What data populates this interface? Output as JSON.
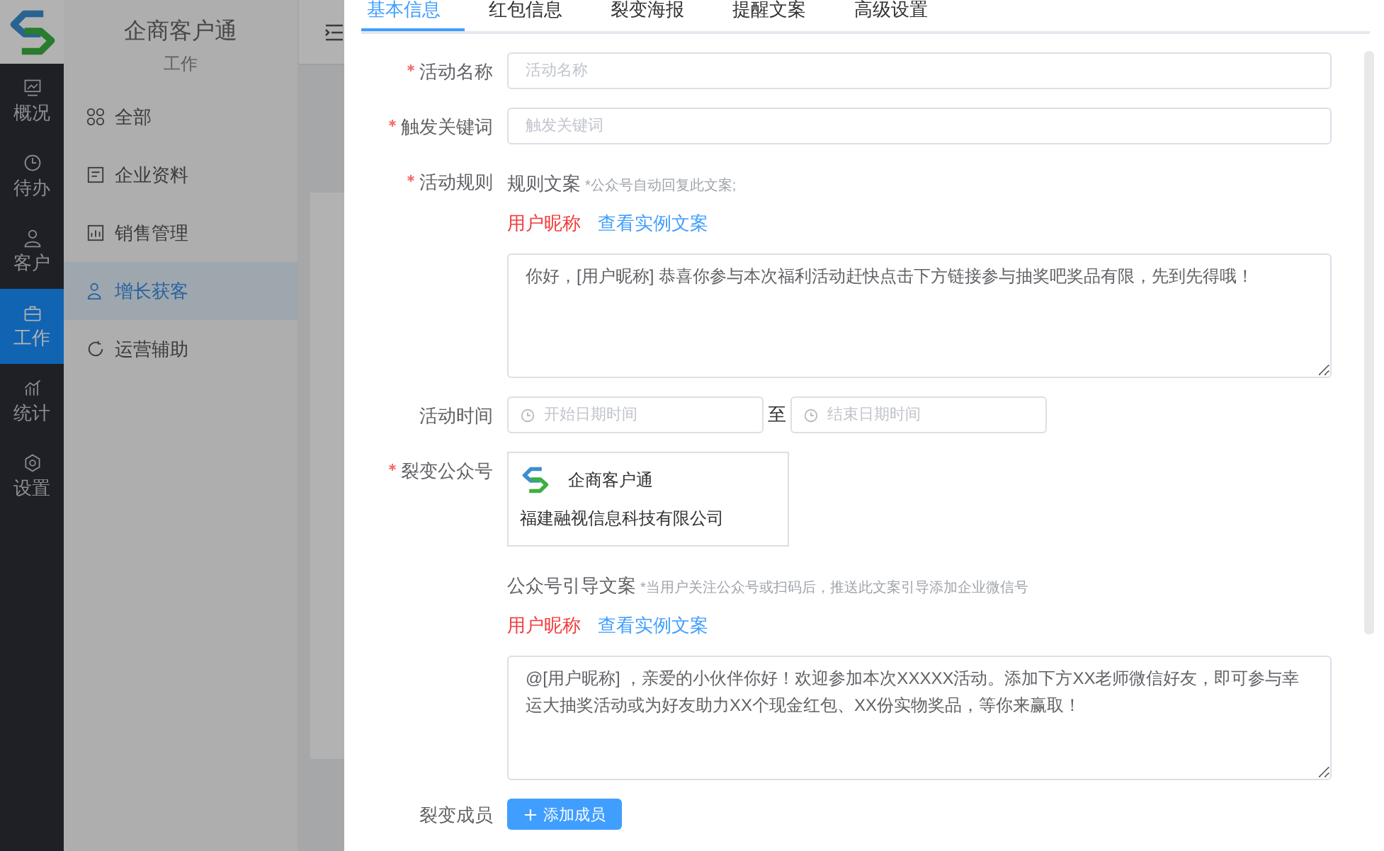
{
  "app": {
    "name": "企商客户通",
    "section": "工作",
    "nav_items": [
      {
        "label": "概况",
        "selected": false
      },
      {
        "label": "待办",
        "selected": false
      },
      {
        "label": "客户",
        "selected": false
      },
      {
        "label": "工作",
        "selected": true
      },
      {
        "label": "统计",
        "selected": false
      },
      {
        "label": "设置",
        "selected": false
      }
    ],
    "sub_menu": [
      {
        "label": "全部",
        "selected": false
      },
      {
        "label": "企业资料",
        "selected": false
      },
      {
        "label": "销售管理",
        "selected": false
      },
      {
        "label": "增长获客",
        "selected": true
      },
      {
        "label": "运营辅助",
        "selected": false
      }
    ]
  },
  "drawer": {
    "tabs": [
      {
        "label": "基本信息",
        "selected": true
      },
      {
        "label": "红包信息",
        "selected": false
      },
      {
        "label": "裂变海报",
        "selected": false
      },
      {
        "label": "提醒文案",
        "selected": false
      },
      {
        "label": "高级设置",
        "selected": false
      }
    ],
    "form": [
      {
        "kind": "input",
        "label": "活动名称",
        "required": true,
        "placeholder": "活动名称"
      },
      {
        "kind": "input",
        "label": "触发关键词",
        "required": true,
        "placeholder": "触发关键词"
      },
      {
        "kind": "copy",
        "label": "活动规则",
        "required": true,
        "title": "规则文案",
        "hint": "*公众号自动回复此文案;",
        "tag": "用户昵称",
        "link": "查看实例文案",
        "value": "你好，[用户昵称] 恭喜你参与本次福利活动赶快点击下方链接参与抽奖吧奖品有限，先到先得哦！"
      },
      {
        "kind": "date_range",
        "label": "活动时间",
        "required": false,
        "start_placeholder": "开始日期时间",
        "separator": "至",
        "end_placeholder": "结束日期时间"
      },
      {
        "kind": "account",
        "label": "裂变公众号",
        "required": true,
        "name": "企商客户通",
        "company": "福建融视信息科技有限公司"
      },
      {
        "kind": "copy",
        "required": false,
        "title": "公众号引导文案",
        "hint": "*当用户关注公众号或扫码后，推送此文案引导添加企业微信号",
        "tag": "用户昵称",
        "link": "查看实例文案",
        "value": "@[用户昵称] ，亲爱的小伙伴你好！欢迎参加本次XXXXX活动。添加下方XX老师微信好友，即可参与幸运大抽奖活动或为好友助力XX个现金红包、XX份实物奖品，等你来赢取！"
      },
      {
        "kind": "button",
        "label": "裂变成员",
        "required": false,
        "button": "添加成员"
      }
    ]
  }
}
